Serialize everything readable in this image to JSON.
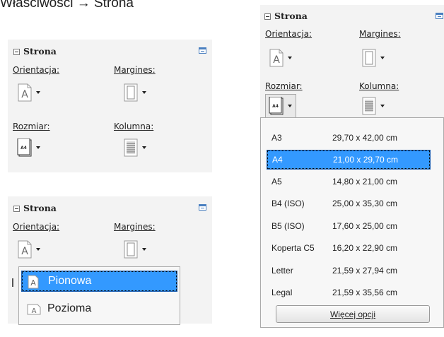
{
  "heading": "Właściwości → Strona",
  "panel": {
    "title": "Strona",
    "orientation_label": "Orientacja:",
    "margins_label": "Margines:",
    "size_label": "Rozmiar:",
    "columns_label": "Kolumna:"
  },
  "orientation_menu": {
    "items": [
      {
        "label": "Pionowa",
        "selected": true
      },
      {
        "label": "Pozioma",
        "selected": false
      }
    ]
  },
  "size_menu": {
    "items": [
      {
        "name": "A3",
        "dims": "29,70 x 42,00 cm",
        "selected": false
      },
      {
        "name": "A4",
        "dims": "21,00 x 29,70 cm",
        "selected": true
      },
      {
        "name": "A5",
        "dims": "14,80 x 21,00 cm",
        "selected": false
      },
      {
        "name": "B4 (ISO)",
        "dims": "25,00 x 35,30 cm",
        "selected": false
      },
      {
        "name": "B5 (ISO)",
        "dims": "17,60 x 25,00 cm",
        "selected": false
      },
      {
        "name": "Koperta C5",
        "dims": "16,20 x 22,90 cm",
        "selected": false
      },
      {
        "name": "Letter",
        "dims": "21,59 x 27,94 cm",
        "selected": false
      },
      {
        "name": "Legal",
        "dims": "21,59 x 35,56 cm",
        "selected": false
      }
    ],
    "more_button": "Więcej opcji"
  },
  "icons": {
    "orientation": "orientation-icon",
    "margins": "margins-icon",
    "size": "paper-size-a4-icon",
    "columns": "columns-icon",
    "a4_glyph": "A4"
  },
  "colors": {
    "selection": "#3399ff",
    "panel_bg": "#f3f3f3",
    "accent_icon": "#4a7fc0"
  }
}
